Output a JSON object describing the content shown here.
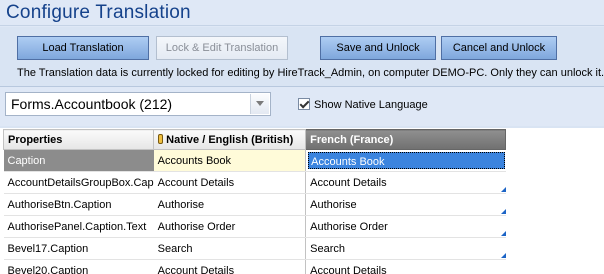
{
  "window": {
    "title": "Configure Translation"
  },
  "toolbar": {
    "load_label": "Load Translation",
    "lock_edit_label": "Lock & Edit Translation",
    "save_unlock_label": "Save and Unlock",
    "cancel_unlock_label": "Cancel and Unlock",
    "lock_message": "The Translation data is currently locked for editing by HireTrack_Admin, on computer DEMO-PC. Only they can unlock it."
  },
  "form_select": {
    "selected": "Forms.Accountbook (212)"
  },
  "show_native": {
    "label": "Show Native Language",
    "checked": true
  },
  "grid": {
    "headers": [
      "Properties",
      "Native / English (British)",
      "French (France)"
    ],
    "rows": [
      {
        "property": "Caption",
        "native": "Accounts Book",
        "french": "Accounts Book",
        "selected": true
      },
      {
        "property": "AccountDetailsGroupBox.Cap",
        "native": "Account Details",
        "french": "Account Details",
        "marker": true
      },
      {
        "property": "AuthoriseBtn.Caption",
        "native": "Authorise",
        "french": "Authorise",
        "marker": true
      },
      {
        "property": "AuthorisePanel.Caption.Text",
        "native": "Authorise Order",
        "french": "Authorise Order",
        "marker": true
      },
      {
        "property": "Bevel17.Caption",
        "native": "Search",
        "french": "Search",
        "marker": true
      },
      {
        "property": "Bevel20.Caption",
        "native": "Account Details",
        "french": "Account Details",
        "marker": true
      }
    ]
  },
  "colors": {
    "selected_cell": "#3b84de",
    "header_active": "#7f7f7f",
    "native_highlight": "#fffbd9"
  }
}
